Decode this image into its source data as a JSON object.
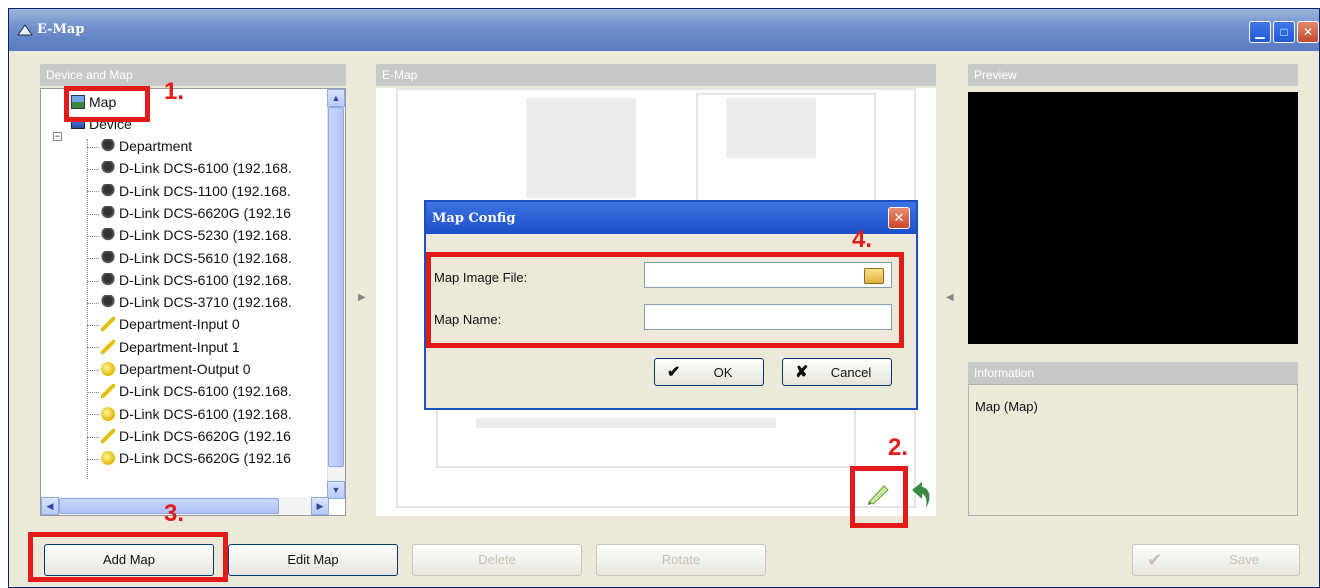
{
  "window": {
    "title": "E-Map"
  },
  "panels": {
    "device_and_map": "Device and Map",
    "emap": "E-Map",
    "preview": "Preview",
    "information": "Information"
  },
  "tree": {
    "map": "Map",
    "device": "Device",
    "items": [
      {
        "label": "Department",
        "icon": "camera-icon"
      },
      {
        "label": "D-Link DCS-6100 (192.168.",
        "icon": "camera-icon"
      },
      {
        "label": "D-Link DCS-1100 (192.168.",
        "icon": "camera-icon"
      },
      {
        "label": "D-Link DCS-6620G (192.16",
        "icon": "camera-icon"
      },
      {
        "label": "D-Link DCS-5230 (192.168.",
        "icon": "camera-icon"
      },
      {
        "label": "D-Link DCS-5610 (192.168.",
        "icon": "camera-icon"
      },
      {
        "label": "D-Link DCS-6100 (192.168.",
        "icon": "camera-icon"
      },
      {
        "label": "D-Link DCS-3710 (192.168.",
        "icon": "camera-icon"
      },
      {
        "label": "Department-Input 0",
        "icon": "pencil-icon"
      },
      {
        "label": "Department-Input 1",
        "icon": "pencil-icon"
      },
      {
        "label": "Department-Output 0",
        "icon": "bulb-icon"
      },
      {
        "label": "D-Link DCS-6100 (192.168.",
        "icon": "pencil-icon"
      },
      {
        "label": "D-Link DCS-6100 (192.168.",
        "icon": "bulb-icon"
      },
      {
        "label": "D-Link DCS-6620G (192.16",
        "icon": "pencil-icon"
      },
      {
        "label": "D-Link DCS-6620G (192.16",
        "icon": "bulb-icon"
      }
    ]
  },
  "dialog": {
    "title": "Map Config",
    "image_file_label": "Map Image File:",
    "image_file_value": "",
    "name_label": "Map Name:",
    "name_value": "",
    "ok": "OK",
    "cancel": "Cancel"
  },
  "information": {
    "text": "Map (Map)"
  },
  "buttons": {
    "add_map": "Add Map",
    "edit_map": "Edit Map",
    "delete": "Delete",
    "rotate": "Rotate",
    "save": "Save"
  },
  "annotations": [
    "1.",
    "2.",
    "3.",
    "4."
  ],
  "colors": {
    "annotation": "#e31b1b",
    "titlebar": "#6f8fcb",
    "dialog_title": "#1d4fc6"
  }
}
